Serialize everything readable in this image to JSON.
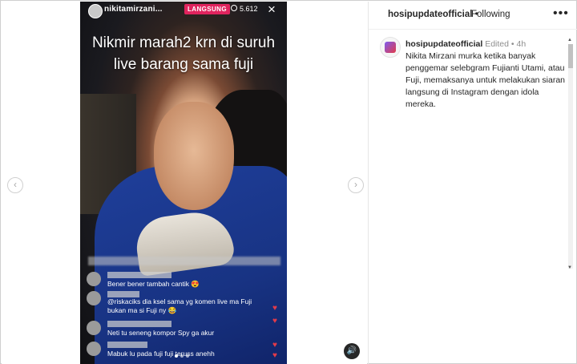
{
  "story": {
    "username": "nikitamirzani...",
    "live_badge": "LANGSUNG",
    "viewer_count": "5.612",
    "close_icon": "×",
    "caption_line1": "Nikmir marah2 krn di suruh",
    "caption_line2": "live barang sama fuji",
    "comments": [
      {
        "text": "Bener bener tambah cantik 😍"
      },
      {
        "text": "@riskaciks dia ksel sama yg komen live ma Fuji"
      },
      {
        "text": "bukan ma si Fuji ny 😂"
      },
      {
        "text": "Neti tu seneng kompor Spy ga akur"
      },
      {
        "text": "Mabuk lu pada fuji fuji teruss anehh"
      }
    ],
    "carousel_dots": 3,
    "active_dot": 1
  },
  "post": {
    "header_username": "hosipupdateofficial",
    "header_separator": "•",
    "follow_status": "Following",
    "more_icon": "•••",
    "author": "hosipupdateofficial",
    "edited_label": "Edited",
    "time_separator": "•",
    "time_ago": "4h",
    "body": "Nikita Mirzani murka ketika banyak penggemar selebgram Fujianti Utami, atau Fuji, memaksanya untuk melakukan siaran langsung di Instagram dengan idola mereka."
  },
  "navigation": {
    "prev_icon": "‹",
    "next_icon": "›",
    "mute_icon": "🔊"
  },
  "colors": {
    "live_badge": "#e0245e",
    "text_primary": "#262626",
    "text_secondary": "#8e8e8e"
  }
}
